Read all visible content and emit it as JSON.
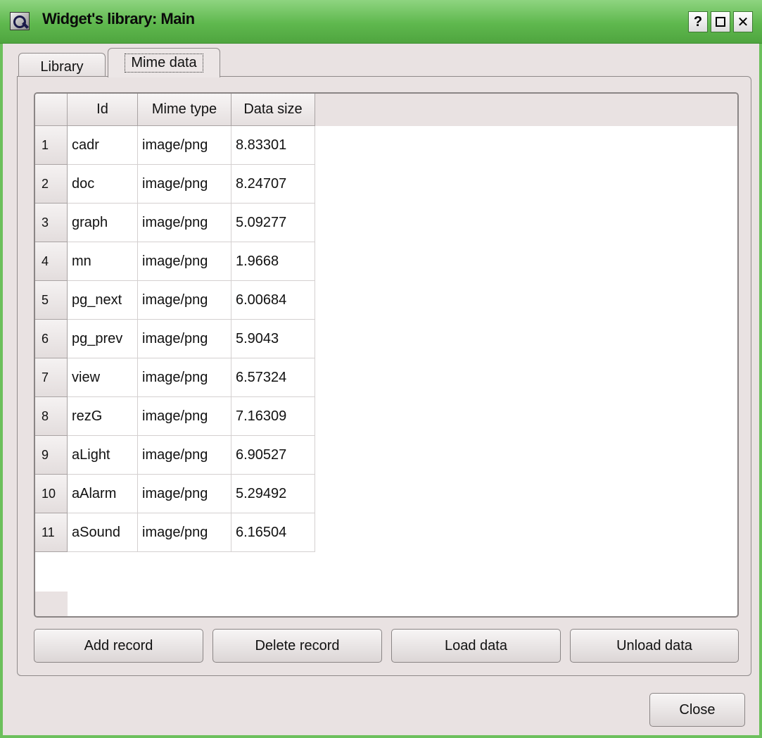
{
  "window": {
    "title": "Widget's library: Main",
    "help_glyph": "?",
    "close_glyph": "✕"
  },
  "tabs": [
    {
      "label": "Library",
      "active": false
    },
    {
      "label": "Mime data",
      "active": true
    }
  ],
  "table": {
    "columns": [
      "Id",
      "Mime type",
      "Data size"
    ],
    "rows": [
      {
        "num": "1",
        "id": "cadr",
        "mime": "image/png",
        "size": "8.83301"
      },
      {
        "num": "2",
        "id": "doc",
        "mime": "image/png",
        "size": "8.24707"
      },
      {
        "num": "3",
        "id": "graph",
        "mime": "image/png",
        "size": "5.09277"
      },
      {
        "num": "4",
        "id": "mn",
        "mime": "image/png",
        "size": "1.9668"
      },
      {
        "num": "5",
        "id": "pg_next",
        "mime": "image/png",
        "size": "6.00684"
      },
      {
        "num": "6",
        "id": "pg_prev",
        "mime": "image/png",
        "size": "5.9043"
      },
      {
        "num": "7",
        "id": "view",
        "mime": "image/png",
        "size": "6.57324"
      },
      {
        "num": "8",
        "id": "rezG",
        "mime": "image/png",
        "size": "7.16309"
      },
      {
        "num": "9",
        "id": "aLight",
        "mime": "image/png",
        "size": "6.90527"
      },
      {
        "num": "10",
        "id": "aAlarm",
        "mime": "image/png",
        "size": "5.29492"
      },
      {
        "num": "11",
        "id": "aSound",
        "mime": "image/png",
        "size": "6.16504"
      }
    ]
  },
  "buttons": {
    "add": "Add record",
    "delete": "Delete record",
    "load": "Load data",
    "unload": "Unload data",
    "close": "Close"
  },
  "colors": {
    "titlebar": "#5fb84e",
    "window_bg": "#e9e2e2"
  }
}
